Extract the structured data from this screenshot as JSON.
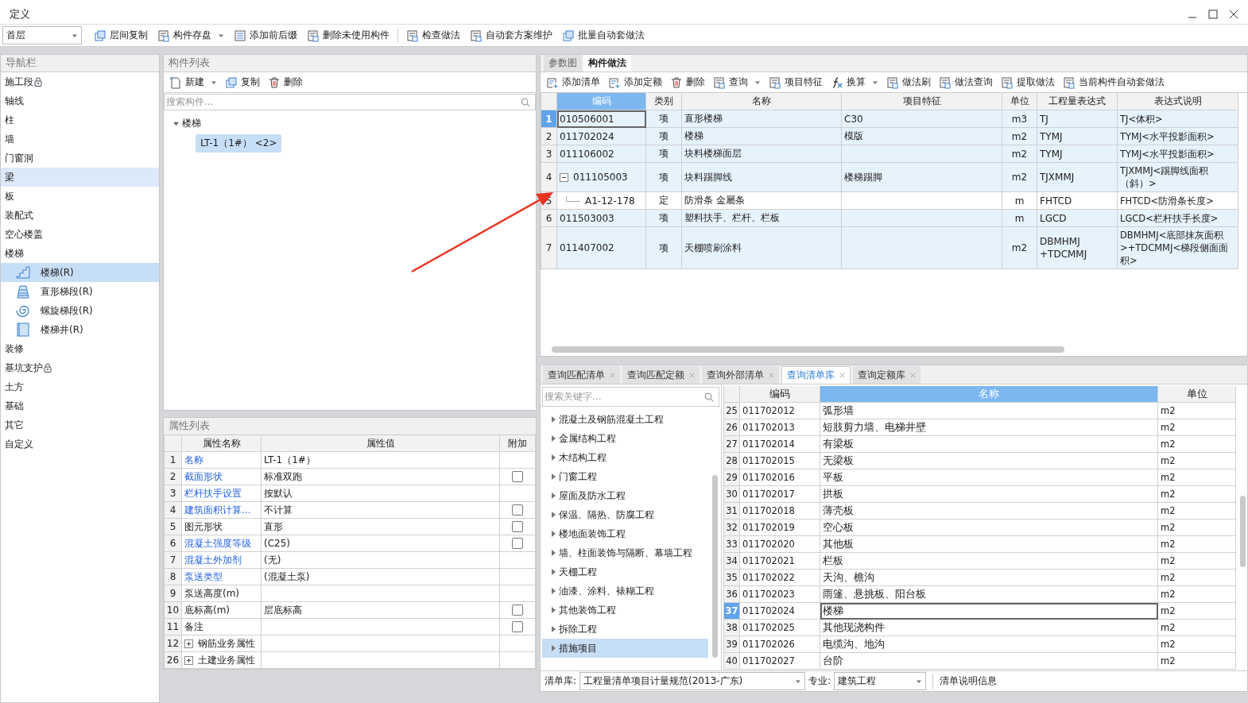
{
  "window": {
    "title": "定义"
  },
  "toolbar": {
    "floor": "首层",
    "buttons": [
      {
        "label": "层间复制",
        "dropdown": false
      },
      {
        "label": "构件存盘",
        "dropdown": true
      },
      {
        "label": "添加前后缀",
        "dropdown": false
      },
      {
        "label": "删除未使用构件",
        "dropdown": false
      },
      {
        "label": "检查做法",
        "dropdown": false
      },
      {
        "label": "自动套方案维护",
        "dropdown": false
      },
      {
        "label": "批量自动套做法",
        "dropdown": false
      }
    ]
  },
  "nav": {
    "title": "导航栏",
    "items": [
      {
        "label": "施工段",
        "locked": true,
        "selected": false
      },
      {
        "label": "轴线",
        "locked": false,
        "selected": false
      },
      {
        "label": "柱",
        "locked": false,
        "selected": false
      },
      {
        "label": "墙",
        "locked": false,
        "selected": false
      },
      {
        "label": "门窗洞",
        "locked": false,
        "selected": false
      },
      {
        "label": "梁",
        "locked": false,
        "selected": true
      },
      {
        "label": "板",
        "locked": false,
        "selected": false
      },
      {
        "label": "装配式",
        "locked": false,
        "selected": false
      },
      {
        "label": "空心楼盖",
        "locked": false,
        "selected": false
      },
      {
        "label": "楼梯",
        "locked": false,
        "selected": false,
        "children": [
          {
            "label": "楼梯(R)",
            "selected": true
          },
          {
            "label": "直形梯段(R)",
            "selected": false
          },
          {
            "label": "螺旋梯段(R)",
            "selected": false
          },
          {
            "label": "楼梯井(R)",
            "selected": false
          }
        ]
      },
      {
        "label": "装修",
        "locked": false,
        "selected": false
      },
      {
        "label": "基坑支护",
        "locked": true,
        "selected": false
      },
      {
        "label": "土方",
        "locked": false,
        "selected": false
      },
      {
        "label": "基础",
        "locked": false,
        "selected": false
      },
      {
        "label": "其它",
        "locked": false,
        "selected": false
      },
      {
        "label": "自定义",
        "locked": false,
        "selected": false
      }
    ]
  },
  "components": {
    "title": "构件列表",
    "buttons": [
      {
        "label": "新建",
        "dropdown": true
      },
      {
        "label": "复制",
        "dropdown": false
      },
      {
        "label": "删除",
        "dropdown": false
      }
    ],
    "search": {
      "placeholder": "搜索构件..."
    },
    "tree": [
      {
        "label": "楼梯",
        "expanded": true,
        "children": [
          {
            "label": "LT-1（1#） <2>",
            "selected": true
          }
        ]
      }
    ]
  },
  "properties": {
    "title": "属性列表",
    "columns": [
      "属性名称",
      "属性值",
      "附加"
    ],
    "rows": [
      {
        "index": "1",
        "name": "名称",
        "value": "LT-1（1#）",
        "linked": true,
        "kind": "text"
      },
      {
        "index": "2",
        "name": "截面形状",
        "value": "标准双跑",
        "linked": true,
        "kind": "check",
        "checked": false
      },
      {
        "index": "3",
        "name": "栏杆扶手设置",
        "value": "按默认",
        "linked": true,
        "kind": "text"
      },
      {
        "index": "4",
        "name": "建筑面积计算...",
        "value": "不计算",
        "linked": true,
        "kind": "check",
        "checked": false
      },
      {
        "index": "5",
        "name": "图元形状",
        "value": "直形",
        "linked": false,
        "kind": "check",
        "checked": false
      },
      {
        "index": "6",
        "name": "混凝土强度等级",
        "value": "(C25)",
        "linked": true,
        "kind": "check",
        "checked": false
      },
      {
        "index": "7",
        "name": "混凝土外加剂",
        "value": "(无)",
        "linked": true,
        "kind": "text"
      },
      {
        "index": "8",
        "name": "泵送类型",
        "value": "(混凝土泵)",
        "linked": true,
        "kind": "text"
      },
      {
        "index": "9",
        "name": "泵送高度(m)",
        "linked": false,
        "kind": "text"
      },
      {
        "index": "10",
        "name": "底标高(m)",
        "value": "层底标高",
        "linked": false,
        "kind": "check",
        "checked": false
      },
      {
        "index": "11",
        "name": "备注",
        "linked": false,
        "kind": "check",
        "checked": false
      },
      {
        "index": "12",
        "name": "钢筋业务属性",
        "linked": false,
        "kind": "group",
        "expanded": false
      },
      {
        "index": "26",
        "name": "土建业务属性",
        "linked": false,
        "kind": "group",
        "expanded": false
      }
    ]
  },
  "method": {
    "tabs": [
      {
        "label": "参数图",
        "selected": false
      },
      {
        "label": "构件做法",
        "selected": true
      }
    ],
    "buttons": [
      {
        "label": "添加清单",
        "dropdown": false
      },
      {
        "label": "添加定额",
        "dropdown": false
      },
      {
        "label": "删除",
        "dropdown": false
      },
      {
        "label": "查询",
        "dropdown": true
      },
      {
        "label": "项目特征",
        "dropdown": false
      },
      {
        "label": "换算",
        "dropdown": true
      },
      {
        "label": "做法刷",
        "dropdown": false
      },
      {
        "label": "做法查询",
        "dropdown": false
      },
      {
        "label": "提取做法",
        "dropdown": false
      },
      {
        "label": "当前构件自动套做法",
        "dropdown": false
      }
    ],
    "columns": [
      {
        "label": "编码",
        "selected": true
      },
      {
        "label": "类别",
        "selected": false
      },
      {
        "label": "名称",
        "selected": false
      },
      {
        "label": "项目特征",
        "selected": false
      },
      {
        "label": "单位",
        "selected": false
      },
      {
        "label": "工程量表达式",
        "selected": false
      },
      {
        "label": "表达式说明",
        "selected": false
      }
    ],
    "rows": [
      {
        "index": "1",
        "kind": "item",
        "selected": true,
        "code": "010506001",
        "type": "项",
        "name": "直形楼梯",
        "feature": "C30",
        "unit": "m3",
        "expr": "TJ",
        "desc": "TJ<体积>"
      },
      {
        "index": "2",
        "kind": "item",
        "selected": false,
        "code": "011702024",
        "type": "项",
        "name": "楼梯",
        "feature": "模版",
        "unit": "m2",
        "expr": "TYMJ",
        "desc": "TYMJ<水平投影面积>"
      },
      {
        "index": "3",
        "kind": "item",
        "selected": false,
        "code": "011106002",
        "type": "项",
        "name": "块料楼梯面层",
        "unit": "m2",
        "expr": "TYMJ",
        "desc": "TYMJ<水平投影面积>"
      },
      {
        "index": "4",
        "kind": "item",
        "selected": false,
        "expanded": true,
        "code": "011105003",
        "type": "项",
        "name": "块料踢脚线",
        "feature": "楼梯踢脚",
        "unit": "m2",
        "expr": "TJXMMJ",
        "desc": "TJXMMJ<踢脚线面积（斜）>"
      },
      {
        "index": "5",
        "kind": "quota",
        "selected": false,
        "code": "A1-12-178",
        "type": "定",
        "name": "防滑条 金屬条",
        "unit": "m",
        "expr": "FHTCD",
        "desc": "FHTCD<防滑条长度>"
      },
      {
        "index": "6",
        "kind": "item",
        "selected": false,
        "code": "011503003",
        "type": "项",
        "name": "塑料扶手、栏杆、栏板",
        "unit": "m",
        "expr": "LGCD",
        "desc": "LGCD<栏杆扶手长度>"
      },
      {
        "index": "7",
        "kind": "item",
        "selected": false,
        "code": "011407002",
        "type": "项",
        "name": "天棚喷刷涂料",
        "unit": "m2",
        "expr": "DBMHMJ +TDCMMJ",
        "desc": "DBMHMJ<底部抹灰面积>+TDCMMJ<梯段侧面面积>"
      }
    ]
  },
  "query": {
    "tabs": [
      {
        "label": "查询匹配清单",
        "selected": false
      },
      {
        "label": "查询匹配定额",
        "selected": false
      },
      {
        "label": "查询外部清单",
        "selected": false
      },
      {
        "label": "查询清单库",
        "selected": true
      },
      {
        "label": "查询定额库",
        "selected": false
      }
    ],
    "search": {
      "placeholder": "搜索关键字..."
    },
    "categories": [
      {
        "label": "混凝土及钢筋混凝土工程",
        "selected": false
      },
      {
        "label": "金属结构工程",
        "selected": false
      },
      {
        "label": "木结构工程",
        "selected": false
      },
      {
        "label": "门窗工程",
        "selected": false
      },
      {
        "label": "屋面及防水工程",
        "selected": false
      },
      {
        "label": "保温、隔热、防腐工程",
        "selected": false
      },
      {
        "label": "楼地面装饰工程",
        "selected": false
      },
      {
        "label": "墙、柱面装饰与隔断、幕墙工程",
        "selected": false
      },
      {
        "label": "天棚工程",
        "selected": false
      },
      {
        "label": "油漆、涂料、裱糊工程",
        "selected": false
      },
      {
        "label": "其他装饰工程",
        "selected": false
      },
      {
        "label": "拆除工程",
        "selected": false
      },
      {
        "label": "措施项目",
        "selected": true
      }
    ],
    "columns": [
      {
        "label": "编码",
        "selected": false
      },
      {
        "label": "名称",
        "selected": true
      },
      {
        "label": "单位",
        "selected": false
      }
    ],
    "rows": [
      {
        "index": "25",
        "code": "011702012",
        "name": "弧形墙",
        "unit": "m2",
        "selected": false
      },
      {
        "index": "26",
        "code": "011702013",
        "name": "短肢剪力墙、电梯井壁",
        "unit": "m2",
        "selected": false
      },
      {
        "index": "27",
        "code": "011702014",
        "name": "有梁板",
        "unit": "m2",
        "selected": false
      },
      {
        "index": "28",
        "code": "011702015",
        "name": "无梁板",
        "unit": "m2",
        "selected": false
      },
      {
        "index": "29",
        "code": "011702016",
        "name": "平板",
        "unit": "m2",
        "selected": false
      },
      {
        "index": "30",
        "code": "011702017",
        "name": "拱板",
        "unit": "m2",
        "selected": false
      },
      {
        "index": "31",
        "code": "011702018",
        "name": "薄壳板",
        "unit": "m2",
        "selected": false
      },
      {
        "index": "32",
        "code": "011702019",
        "name": "空心板",
        "unit": "m2",
        "selected": false
      },
      {
        "index": "33",
        "code": "011702020",
        "name": "其他板",
        "unit": "m2",
        "selected": false
      },
      {
        "index": "34",
        "code": "011702021",
        "name": "栏板",
        "unit": "m2",
        "selected": false
      },
      {
        "index": "35",
        "code": "011702022",
        "name": "天沟、檐沟",
        "unit": "m2",
        "selected": false
      },
      {
        "index": "36",
        "code": "011702023",
        "name": "雨篷、悬挑板、阳台板",
        "unit": "m2",
        "selected": false
      },
      {
        "index": "37",
        "code": "011702024",
        "name": "楼梯",
        "unit": "m2",
        "selected": true
      },
      {
        "index": "38",
        "code": "011702025",
        "name": "其他现浇构件",
        "unit": "m2",
        "selected": false
      },
      {
        "index": "39",
        "code": "011702026",
        "name": "电缆沟、地沟",
        "unit": "m2",
        "selected": false
      },
      {
        "index": "40",
        "code": "011702027",
        "name": "台阶",
        "unit": "m2",
        "selected": false
      }
    ],
    "footer": {
      "library_label": "清单库:",
      "library": "工程量清单项目计量规范(2013-广东)",
      "specialty_label": "专业:",
      "specialty": "建筑工程",
      "info": "清单说明信息"
    }
  }
}
